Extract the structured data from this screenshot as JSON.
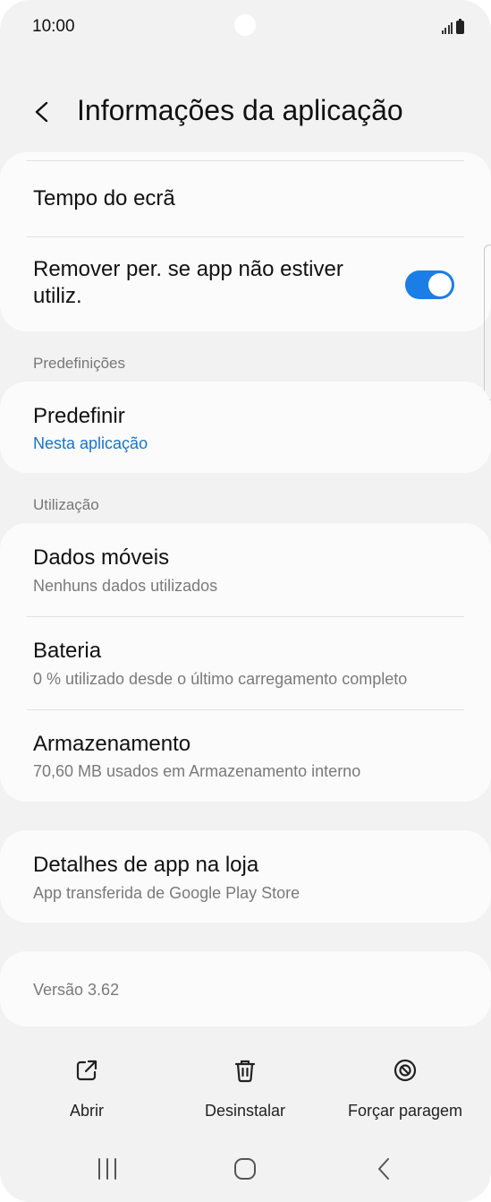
{
  "status_bar": {
    "time": "10:00"
  },
  "header": {
    "title": "Informações da aplicação"
  },
  "items": {
    "screen_time": {
      "title": "Tempo do ecrã"
    },
    "remove_permissions": {
      "title_line1": "Remover per. se app não estiver",
      "title_line2": "utiliz.",
      "toggle_on": true
    },
    "defaults_section": "Predefinições",
    "defaults": {
      "title": "Predefinir",
      "subtitle": "Nesta aplicação"
    },
    "usage_section": "Utilização",
    "mobile_data": {
      "title": "Dados móveis",
      "subtitle": "Nenhuns dados utilizados"
    },
    "battery": {
      "title": "Bateria",
      "subtitle": "0 % utilizado desde o último carregamento completo"
    },
    "storage": {
      "title": "Armazenamento",
      "subtitle": "70,60 MB usados em Armazenamento interno"
    },
    "store_details": {
      "title": "Detalhes de app na loja",
      "subtitle": "App transferida de Google Play Store"
    },
    "version": "Versão 3.62"
  },
  "actions": {
    "open": "Abrir",
    "uninstall": "Desinstalar",
    "force_stop": "Forçar paragem"
  },
  "colors": {
    "accent": "#1a7ee6",
    "link": "#1875c8",
    "background": "#f2f2f2",
    "card": "#fbfbfb"
  },
  "icons": [
    "back-arrow-icon",
    "open-external-icon",
    "trash-icon",
    "force-stop-icon",
    "recents-icon",
    "home-icon",
    "nav-back-icon"
  ]
}
